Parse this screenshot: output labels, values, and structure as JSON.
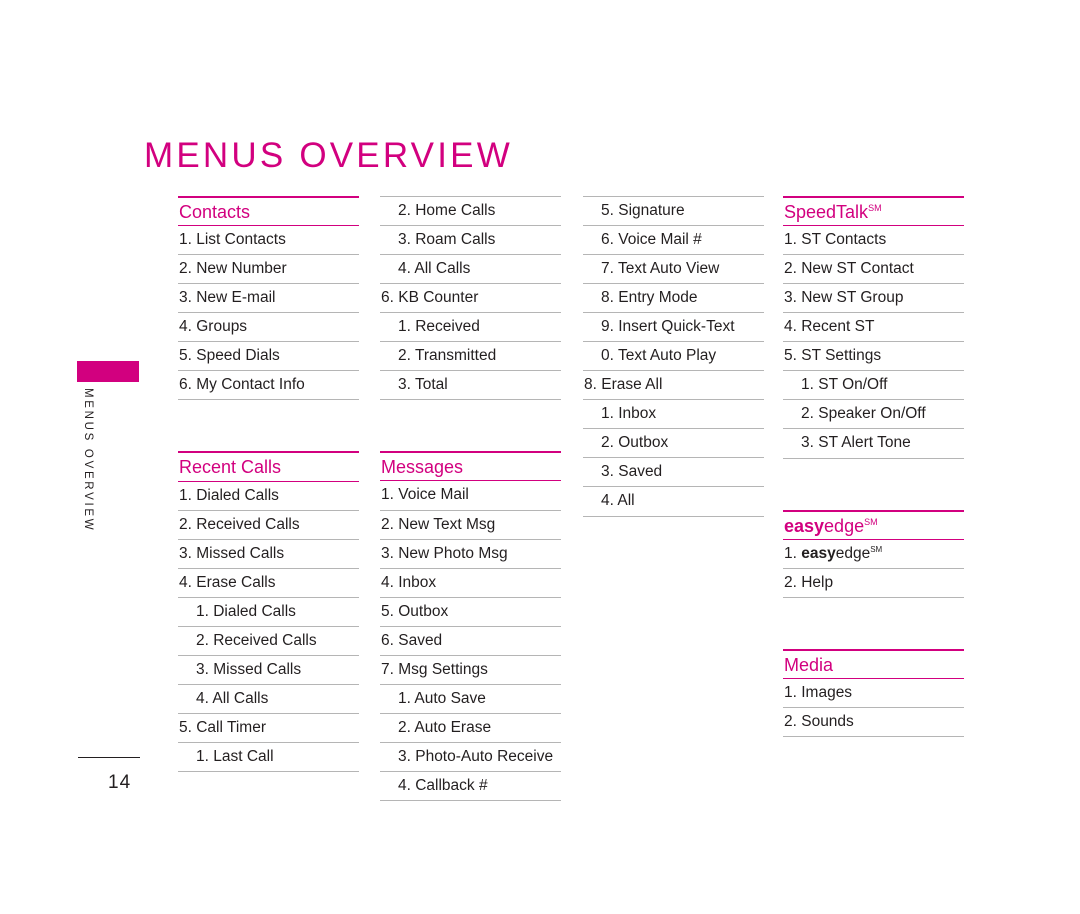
{
  "page": {
    "title": "MENUS OVERVIEW",
    "side_tab_label": "MENUS OVERVIEW",
    "page_number": "14",
    "accent_color": "#d2007f",
    "text_color": "#231f20",
    "rule_color": "#b5b5b5"
  },
  "columns": [
    {
      "id": "column-1",
      "blocks": [
        {
          "type": "section",
          "heading": "Contacts",
          "items": [
            {
              "label": "1. List Contacts",
              "level": 0
            },
            {
              "label": "2. New Number",
              "level": 0
            },
            {
              "label": "3. New E-mail",
              "level": 0
            },
            {
              "label": "4. Groups",
              "level": 0
            },
            {
              "label": "5. Speed Dials",
              "level": 0
            },
            {
              "label": "6. My Contact Info",
              "level": 0
            }
          ]
        },
        {
          "type": "section",
          "heading": "Recent Calls",
          "items": [
            {
              "label": "1. Dialed Calls",
              "level": 0
            },
            {
              "label": "2. Received Calls",
              "level": 0
            },
            {
              "label": "3. Missed Calls",
              "level": 0
            },
            {
              "label": "4. Erase Calls",
              "level": 0
            },
            {
              "label": "1. Dialed Calls",
              "level": 1
            },
            {
              "label": "2. Received Calls",
              "level": 1
            },
            {
              "label": "3. Missed Calls",
              "level": 1
            },
            {
              "label": "4. All Calls",
              "level": 1
            },
            {
              "label": "5. Call Timer",
              "level": 0
            },
            {
              "label": "1. Last Call",
              "level": 1
            }
          ]
        }
      ]
    },
    {
      "id": "column-2",
      "blocks": [
        {
          "type": "continuation",
          "items": [
            {
              "label": "2. Home Calls",
              "level": 1
            },
            {
              "label": "3. Roam Calls",
              "level": 1
            },
            {
              "label": "4. All Calls",
              "level": 1
            },
            {
              "label": "6. KB Counter",
              "level": 0
            },
            {
              "label": "1. Received",
              "level": 1
            },
            {
              "label": "2. Transmitted",
              "level": 1
            },
            {
              "label": "3. Total",
              "level": 1
            }
          ]
        },
        {
          "type": "section",
          "heading": "Messages",
          "items": [
            {
              "label": "1. Voice Mail",
              "level": 0
            },
            {
              "label": "2. New Text Msg",
              "level": 0
            },
            {
              "label": "3. New Photo Msg",
              "level": 0
            },
            {
              "label": "4. Inbox",
              "level": 0
            },
            {
              "label": "5. Outbox",
              "level": 0
            },
            {
              "label": "6. Saved",
              "level": 0
            },
            {
              "label": "7. Msg Settings",
              "level": 0
            },
            {
              "label": "1. Auto Save",
              "level": 1
            },
            {
              "label": "2. Auto Erase",
              "level": 1
            },
            {
              "label": "3. Photo-Auto Receive",
              "level": 1
            },
            {
              "label": "4. Callback #",
              "level": 1
            }
          ]
        }
      ]
    },
    {
      "id": "column-3",
      "blocks": [
        {
          "type": "continuation",
          "items": [
            {
              "label": "5. Signature",
              "level": 1
            },
            {
              "label": "6. Voice Mail #",
              "level": 1
            },
            {
              "label": "7. Text Auto View",
              "level": 1
            },
            {
              "label": "8. Entry Mode",
              "level": 1
            },
            {
              "label": "9. Insert Quick-Text",
              "level": 1
            },
            {
              "label": "0. Text Auto Play",
              "level": 1
            },
            {
              "label": "8. Erase All",
              "level": 0
            },
            {
              "label": "1. Inbox",
              "level": 1
            },
            {
              "label": "2. Outbox",
              "level": 1
            },
            {
              "label": "3. Saved",
              "level": 1
            },
            {
              "label": "4. All",
              "level": 1
            }
          ]
        }
      ]
    },
    {
      "id": "column-4",
      "blocks": [
        {
          "type": "section",
          "heading": "SpeedTalk",
          "heading_sup": "SM",
          "items": [
            {
              "label": "1. ST Contacts",
              "level": 0
            },
            {
              "label": "2. New ST Contact",
              "level": 0
            },
            {
              "label": "3. New ST Group",
              "level": 0
            },
            {
              "label": "4. Recent ST",
              "level": 0
            },
            {
              "label": "5. ST Settings",
              "level": 0
            },
            {
              "label": "1. ST On/Off",
              "level": 1
            },
            {
              "label": "2. Speaker On/Off",
              "level": 1
            },
            {
              "label": "3. ST Alert Tone",
              "level": 1
            }
          ]
        },
        {
          "type": "section",
          "heading_bold": "easy",
          "heading": "edge",
          "heading_sup": "SM",
          "items": [
            {
              "label": "1. ",
              "bold": "easy",
              "rest": "edge",
              "sup": "SM",
              "level": 0
            },
            {
              "label": "2. Help",
              "level": 0
            }
          ]
        },
        {
          "type": "section",
          "heading": "Media",
          "items": [
            {
              "label": "1. Images",
              "level": 0
            },
            {
              "label": "2. Sounds",
              "level": 0
            }
          ]
        }
      ]
    }
  ]
}
